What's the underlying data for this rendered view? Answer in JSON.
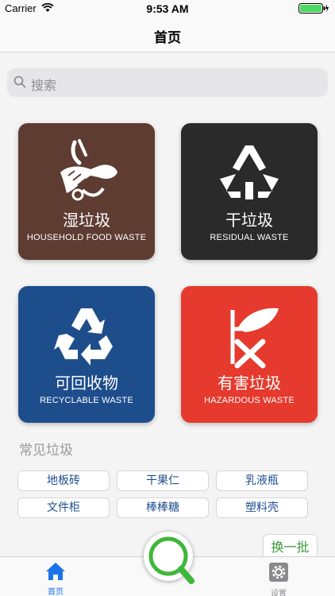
{
  "status_bar": {
    "carrier": "Carrier",
    "time": "9:53 AM"
  },
  "nav": {
    "title": "首页"
  },
  "search": {
    "placeholder": "搜索"
  },
  "categories": [
    {
      "cn": "湿垃圾",
      "en": "HOUSEHOLD FOOD WASTE",
      "color": "#5e3c32",
      "icon": "food-waste-icon"
    },
    {
      "cn": "干垃圾",
      "en": "RESIDUAL WASTE",
      "color": "#2a2a2a",
      "icon": "residual-waste-icon"
    },
    {
      "cn": "可回收物",
      "en": "RECYCLABLE WASTE",
      "color": "#1e4d8c",
      "icon": "recycle-icon"
    },
    {
      "cn": "有害垃圾",
      "en": "HAZARDOUS WASTE",
      "color": "#e53a2d",
      "icon": "hazardous-waste-icon"
    }
  ],
  "common_waste": {
    "title": "常见垃圾",
    "items": [
      "地板砖",
      "干果仁",
      "乳液瓶",
      "文件柜",
      "棒棒糖",
      "塑料壳"
    ],
    "refresh_label": "换一批"
  },
  "tab_bar": {
    "items": [
      {
        "label": "首页",
        "icon": "home-icon",
        "active": true
      },
      {
        "label": "设置",
        "icon": "settings-icon",
        "active": false
      }
    ],
    "active_color": "#1a73e8",
    "inactive_color": "#8e8e93"
  },
  "fab": {
    "icon": "search-icon",
    "accent": "#3fb73a"
  }
}
